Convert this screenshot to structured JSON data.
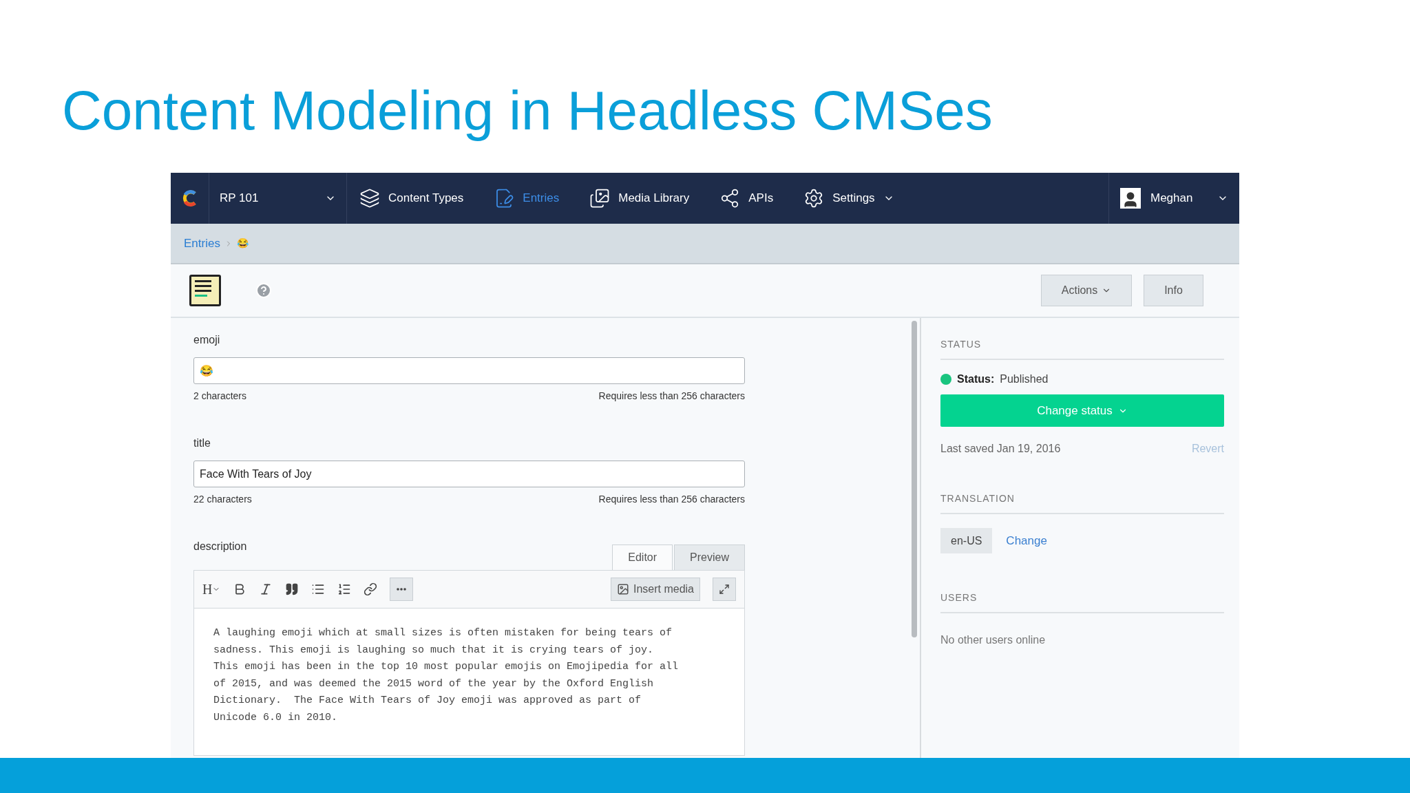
{
  "slide_title": "Content Modeling in Headless CMSes",
  "nav": {
    "space": "RP 101",
    "items": [
      {
        "kind": "content-types",
        "label": "Content Types",
        "selected": false
      },
      {
        "kind": "entries",
        "label": "Entries",
        "selected": true
      },
      {
        "kind": "media",
        "label": "Media Library",
        "selected": false
      },
      {
        "kind": "apis",
        "label": "APIs",
        "selected": false
      },
      {
        "kind": "settings",
        "label": "Settings",
        "selected": false
      }
    ],
    "user": "Meghan"
  },
  "breadcrumb": [
    "Entries",
    "😂"
  ],
  "toolbar": {
    "buttons": [
      "Actions",
      "Info"
    ]
  },
  "fields": [
    {
      "label": "emoji",
      "value": "😂",
      "count": "2 characters",
      "hint": "Requires less than 256 characters"
    },
    {
      "label": "title",
      "value": "Face With Tears of Joy",
      "count": "22 characters",
      "hint": "Requires less than 256 characters"
    }
  ],
  "description": {
    "label": "description",
    "tabs": [
      {
        "label": "Editor",
        "selected": true
      },
      {
        "label": "Preview",
        "selected": false
      }
    ],
    "heading_button": "H",
    "insert_media": "Insert media",
    "text": "A laughing emoji which at small sizes is often mistaken for being tears of\nsadness. This emoji is laughing so much that it is crying tears of joy.\nThis emoji has been in the top 10 most popular emojis on Emojipedia for all\nof 2015, and was deemed the 2015 word of the year by the Oxford English\nDictionary.  The Face With Tears of Joy emoji was approved as part of\nUnicode 6.0 in 2010."
  },
  "sidebar": {
    "status": {
      "heading": "STATUS",
      "label": "Status:",
      "value": "Published",
      "color": "#19c47f",
      "button": "Change status",
      "saved": "Last saved Jan 19, 2016",
      "revert": "Revert"
    },
    "translation": {
      "heading": "TRANSLATION",
      "locale": "en-US",
      "change": "Change"
    },
    "users": {
      "heading": "USERS",
      "text": "No other users online"
    }
  }
}
